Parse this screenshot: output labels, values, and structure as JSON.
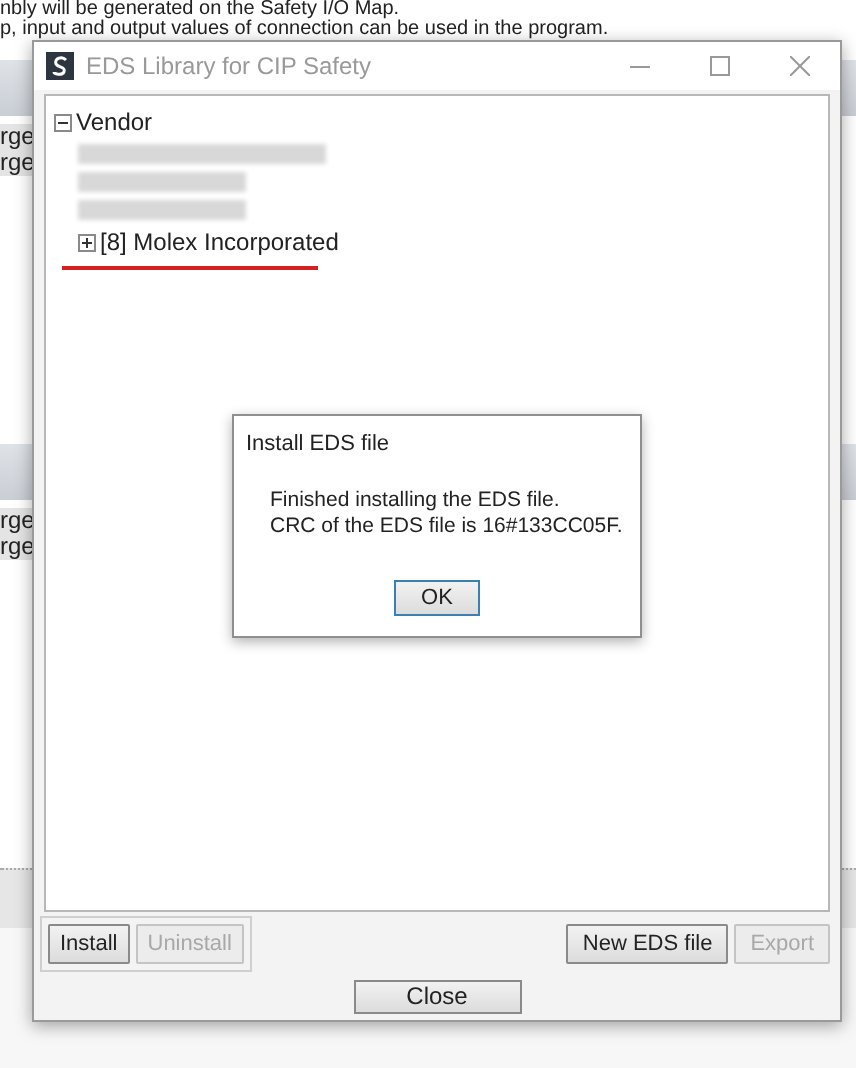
{
  "background": {
    "lines": [
      "nbly will be generated on the Safety I/O Map.",
      "p, input and output values of connection can be used in the program."
    ],
    "upper_rows": [
      "rge",
      "rge"
    ],
    "lower_rows": [
      "rge",
      "rge"
    ]
  },
  "window": {
    "title": "EDS Library for CIP Safety"
  },
  "tree": {
    "label": "Vendor",
    "expanded": true,
    "children": [
      {
        "label": "[8] Molex Incorporated",
        "expanded": false,
        "highlighted": true
      }
    ]
  },
  "left_buttons": [
    {
      "label": "Install",
      "disabled": false
    },
    {
      "label": "Uninstall",
      "disabled": true
    }
  ],
  "right_buttons": [
    {
      "label": "New EDS file",
      "disabled": false
    },
    {
      "label": "Export",
      "disabled": true
    }
  ],
  "close_button": "Close",
  "modal": {
    "title": "Install EDS file",
    "message": [
      "Finished installing the EDS file.",
      "CRC of the EDS file is 16#133CC05F."
    ],
    "button": "OK"
  }
}
